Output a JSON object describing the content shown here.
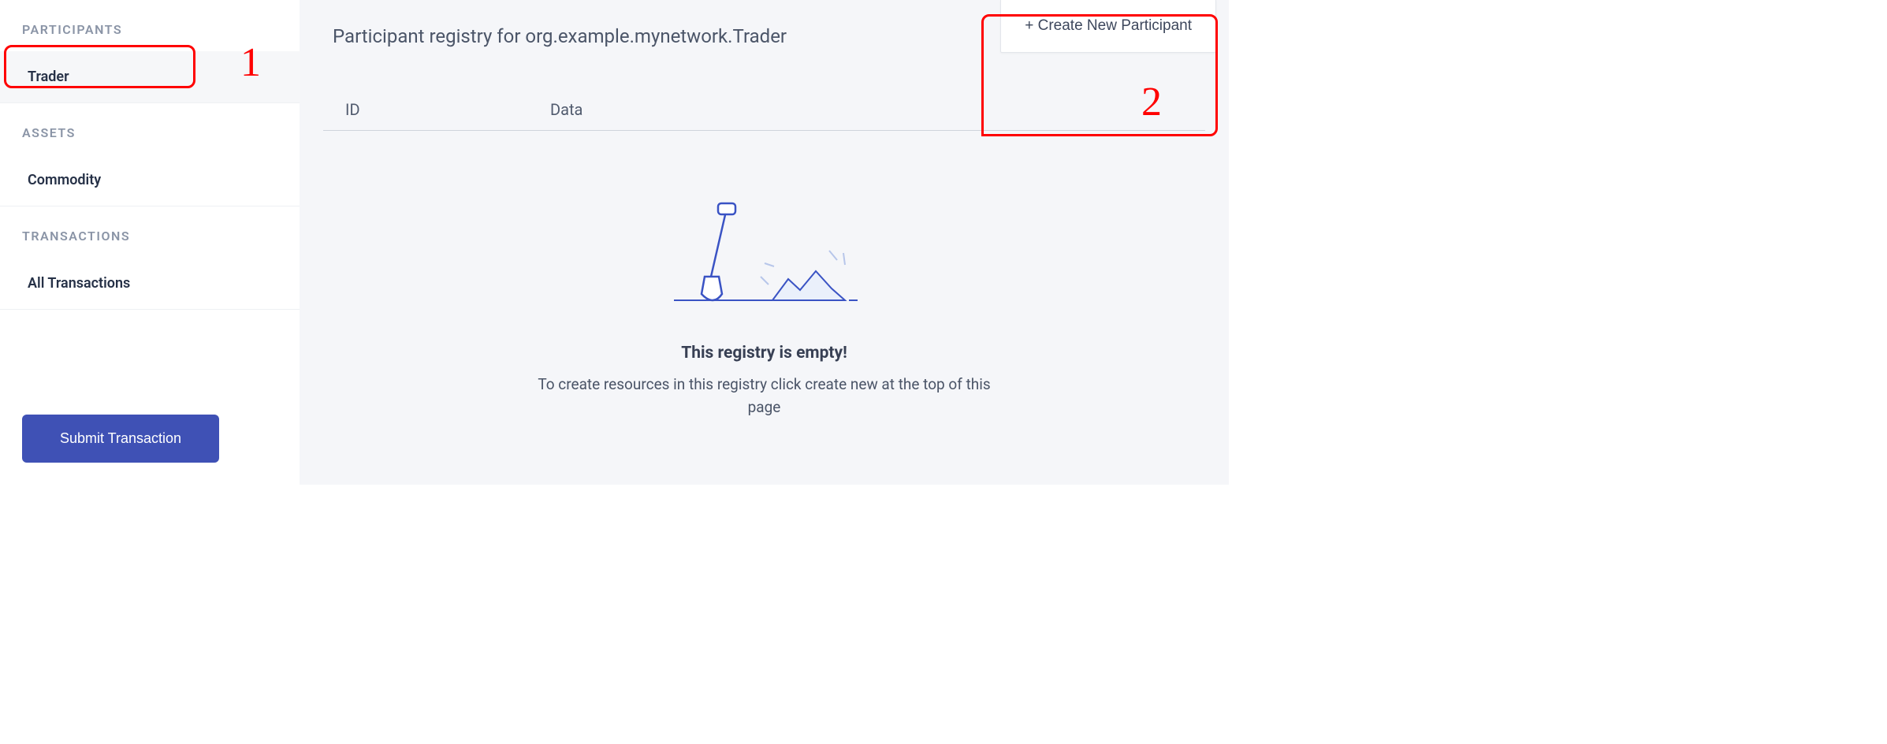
{
  "sidebar": {
    "sections": [
      {
        "header": "PARTICIPANTS",
        "items": [
          {
            "label": "Trader",
            "active": true
          }
        ]
      },
      {
        "header": "ASSETS",
        "items": [
          {
            "label": "Commodity",
            "active": false
          }
        ]
      },
      {
        "header": "TRANSACTIONS",
        "items": [
          {
            "label": "All Transactions",
            "active": false
          }
        ]
      }
    ],
    "submit_label": "Submit Transaction"
  },
  "main": {
    "page_title": "Participant registry for org.example.mynetwork.Trader",
    "create_button": "+ Create New Participant",
    "table": {
      "columns": {
        "id": "ID",
        "data": "Data"
      },
      "rows": []
    },
    "empty_state": {
      "title": "This registry is empty!",
      "description": "To create resources in this registry click create new at the top of this page"
    }
  },
  "annotations": {
    "one": "1",
    "two": "2"
  }
}
